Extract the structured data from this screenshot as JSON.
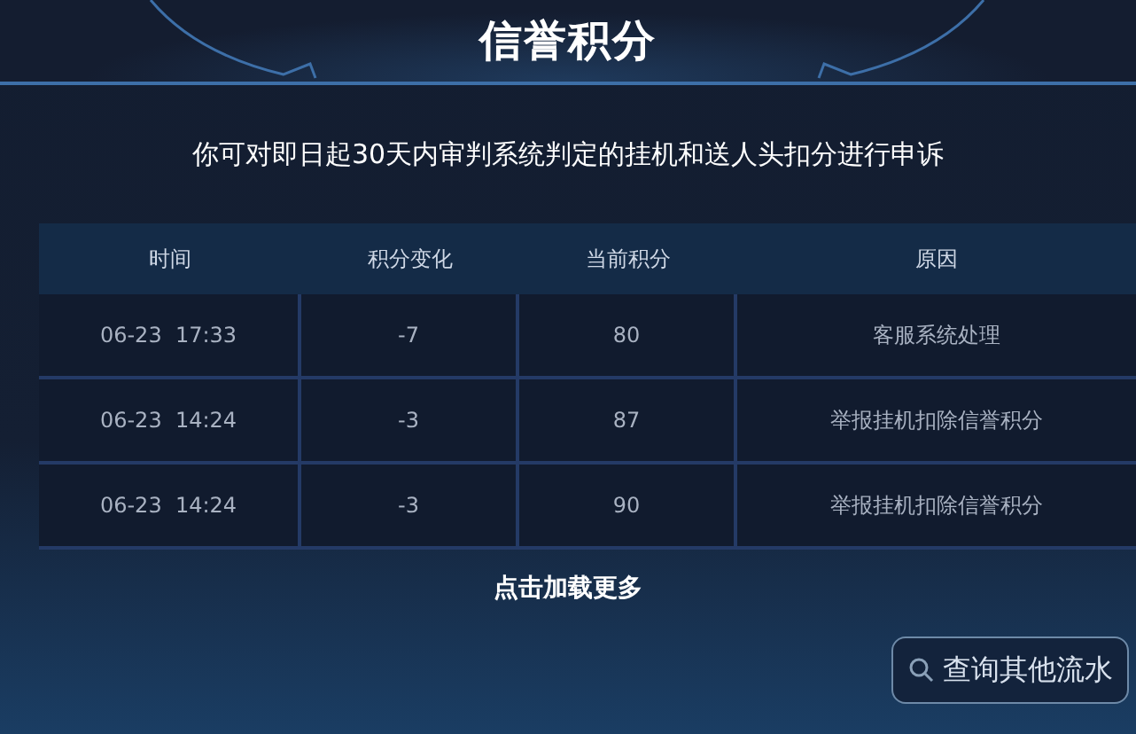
{
  "title": "信誉积分",
  "notice": "你可对即日起30天内审判系统判定的挂机和送人头扣分进行申诉",
  "table": {
    "columns": [
      "时间",
      "积分变化",
      "当前积分",
      "原因"
    ],
    "rows": [
      [
        "06-23  17:33",
        "-7",
        "80",
        "客服系统处理"
      ],
      [
        "06-23  14:24",
        "-3",
        "87",
        "举报挂机扣除信誉积分"
      ],
      [
        "06-23  14:24",
        "-3",
        "90",
        "举报挂机扣除信誉积分"
      ]
    ]
  },
  "load_more": "点击加载更多",
  "search_button": "查询其他流水"
}
